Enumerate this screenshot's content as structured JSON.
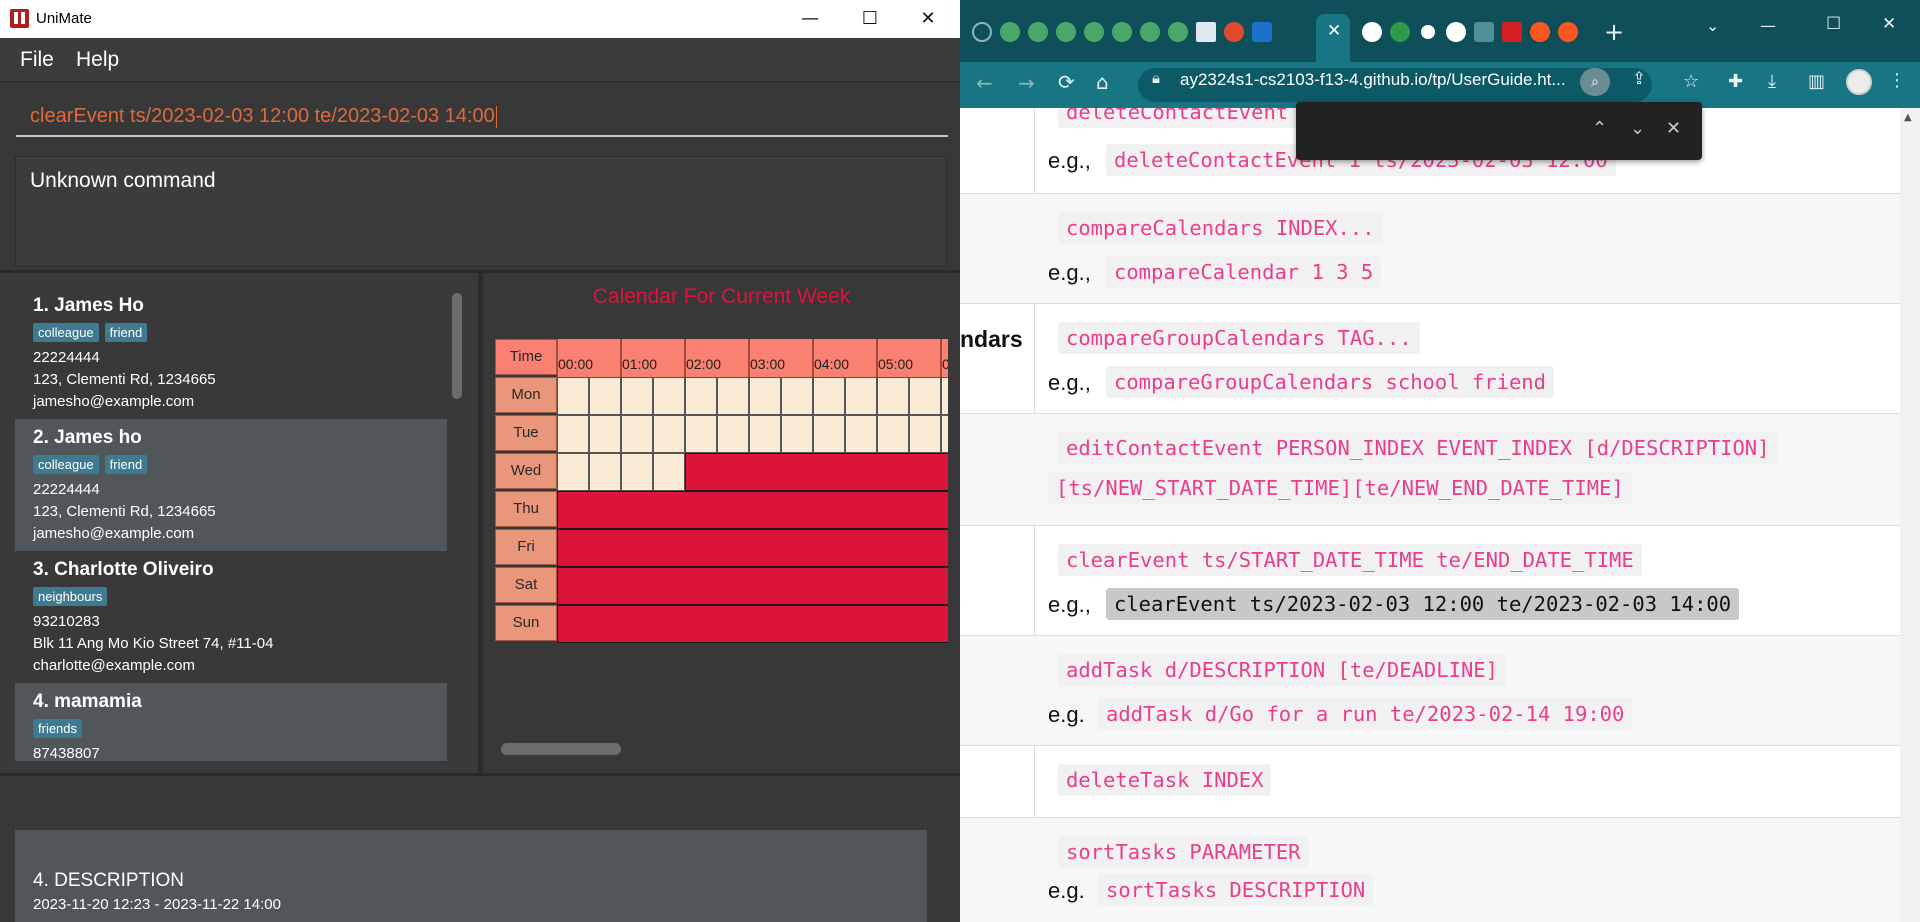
{
  "unimate": {
    "app_title": "UniMate",
    "window_controls": {
      "minimize": "—",
      "maximize": "☐",
      "close": "✕"
    },
    "menu": [
      "File",
      "Help"
    ],
    "command_text": "clearEvent ts/2023-02-03 12:00 te/2023-02-03 14:00",
    "result_text": "Unknown command",
    "persons": [
      {
        "index_name": "1.  James Ho",
        "tags": [
          "colleague",
          "friend"
        ],
        "phone": "22224444",
        "address": "123, Clementi Rd, 1234665",
        "email": "jamesho@example.com"
      },
      {
        "index_name": "2.  James ho",
        "tags": [
          "colleague",
          "friend"
        ],
        "phone": "22224444",
        "address": "123, Clementi Rd, 1234665",
        "email": "jamesho@example.com"
      },
      {
        "index_name": "3.  Charlotte Oliveiro",
        "tags": [
          "neighbours"
        ],
        "phone": "93210283",
        "address": "Blk 11 Ang Mo Kio Street 74, #11-04",
        "email": "charlotte@example.com"
      },
      {
        "index_name": "4.  mamamia",
        "tags": [
          "friends"
        ],
        "phone": "87438807",
        "address": "",
        "email": ""
      }
    ],
    "calendar": {
      "title": "Calendar For Current Week",
      "time_label": "Time",
      "days": [
        "Mon",
        "Tue",
        "Wed",
        "Thu",
        "Fri",
        "Sat",
        "Sun"
      ],
      "hours": [
        "00:00",
        "01:00",
        "02:00",
        "03:00",
        "04:00",
        "05:00",
        "0"
      ],
      "busy_from_halfhour": [
        null,
        null,
        4,
        0,
        0,
        0,
        0
      ]
    },
    "event": {
      "title": "4.  DESCRIPTION",
      "time": "2023-11-20 12:23 - 2023-11-22 14:00"
    },
    "colors": {
      "accent_red": "#dc143c",
      "salmon": "#fa8072",
      "free_slot": "#faebd7",
      "tag_blue": "#3e7b91",
      "command_orange": "#e0683e"
    }
  },
  "browser": {
    "url": "ay2324s1-cs2103-f13-4.github.io/tp/UserGuide.ht...",
    "tab_close": "✕",
    "new_tab": "+",
    "nav": {
      "back": "←",
      "forward": "→",
      "reload": "⟳",
      "home": "⌂"
    },
    "find_controls": {
      "up": "⌃",
      "down": "⌄",
      "close": "✕"
    },
    "left_label_partial": "ndars",
    "rows": [
      {
        "cmd": "deleteContactEvent",
        "eg_label": "e.g.,",
        "eg": "deleteContactEvent 1 ts/2023-02-03 12:00"
      },
      {
        "cmd": "compareCalendars INDEX...",
        "eg_label": "e.g.,",
        "eg": "compareCalendar 1 3 5"
      },
      {
        "cmd": "compareGroupCalendars TAG...",
        "eg_label": "e.g.,",
        "eg": "compareGroupCalendars school friend"
      },
      {
        "cmd": "editContactEvent PERSON_INDEX EVENT_INDEX [d/DESCRIPTION]",
        "cmd2": "[ts/NEW_START_DATE_TIME][te/NEW_END_DATE_TIME]"
      },
      {
        "cmd": "clearEvent ts/START_DATE_TIME te/END_DATE_TIME",
        "eg_label": "e.g.,",
        "eg": "clearEvent ts/2023-02-03 12:00 te/2023-02-03 14:00"
      },
      {
        "cmd": "addTask d/DESCRIPTION [te/DEADLINE]",
        "eg_label": "e.g.",
        "eg": "addTask d/Go for a run te/2023-02-14 19:00"
      },
      {
        "cmd": "deleteTask INDEX"
      },
      {
        "cmd": "sortTasks PARAMETER",
        "eg_label": "e.g.",
        "eg": "sortTasks DESCRIPTION"
      }
    ]
  }
}
